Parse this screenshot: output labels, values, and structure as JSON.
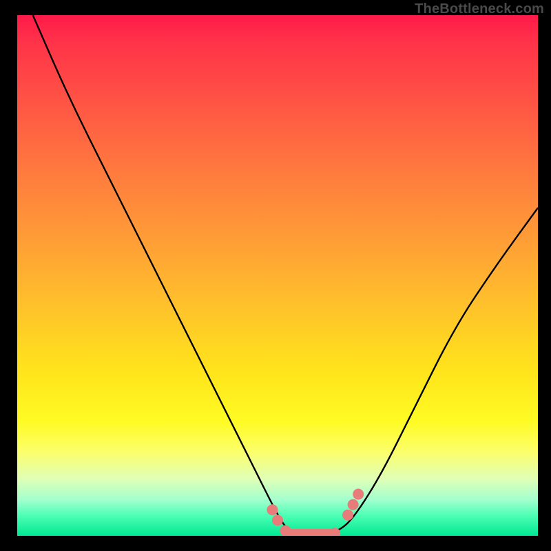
{
  "attribution": "TheBottleneck.com",
  "colors": {
    "background": "#000000",
    "curve": "#000000",
    "marker": "#e77c7b",
    "gradient_top": "#ff1a49",
    "gradient_bottom": "#00e892"
  },
  "chart_data": {
    "type": "line",
    "title": "",
    "xlabel": "",
    "ylabel": "",
    "xlim": [
      0,
      100
    ],
    "ylim": [
      0,
      100
    ],
    "grid": false,
    "series": [
      {
        "name": "bottleneck-curve",
        "x": [
          3,
          10,
          18,
          26,
          34,
          40,
          46,
          50,
          52,
          55,
          58,
          62,
          65,
          70,
          76,
          84,
          92,
          100
        ],
        "values": [
          100,
          84,
          68,
          52,
          36,
          24,
          12,
          4,
          1,
          0,
          0,
          1,
          4,
          12,
          24,
          40,
          52,
          63
        ]
      }
    ],
    "markers": [
      {
        "x": 49,
        "y": 5
      },
      {
        "x": 50,
        "y": 3
      },
      {
        "x": 51.5,
        "y": 1
      },
      {
        "x": 54,
        "y": 0
      },
      {
        "x": 56,
        "y": 0
      },
      {
        "x": 58,
        "y": 0
      },
      {
        "x": 61,
        "y": 0.5
      },
      {
        "x": 63.5,
        "y": 4
      },
      {
        "x": 64.5,
        "y": 6
      },
      {
        "x": 65.5,
        "y": 8
      }
    ],
    "flat_bar": {
      "x_start": 51,
      "x_end": 62,
      "y": 0
    }
  }
}
